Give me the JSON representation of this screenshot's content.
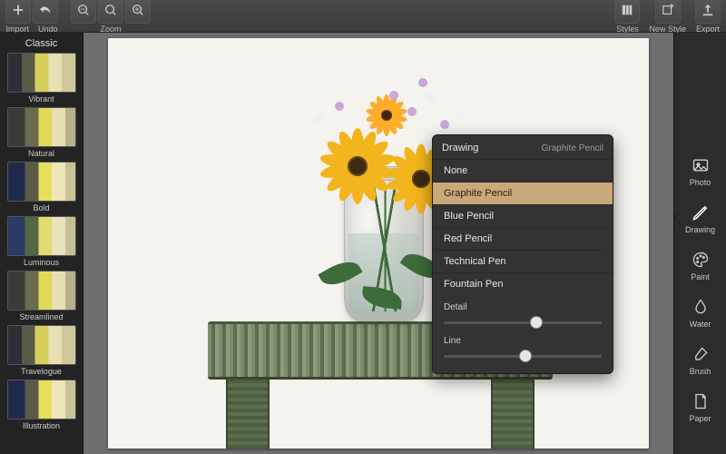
{
  "toolbar": {
    "import_label": "Import",
    "undo_label": "Undo",
    "zoom_label": "Zoom",
    "styles_label": "Styles",
    "new_style_label": "New Style",
    "export_label": "Export"
  },
  "sidebar": {
    "title": "Classic",
    "presets": [
      {
        "label": "Vibrant"
      },
      {
        "label": "Natural"
      },
      {
        "label": "Bold"
      },
      {
        "label": "Luminous"
      },
      {
        "label": "Streamlined"
      },
      {
        "label": "Travelogue"
      },
      {
        "label": "Illustration"
      }
    ]
  },
  "panel": {
    "title": "Drawing",
    "subtitle": "Graphite Pencil",
    "options": [
      {
        "label": "None",
        "selected": false
      },
      {
        "label": "Graphite Pencil",
        "selected": true
      },
      {
        "label": "Blue Pencil",
        "selected": false
      },
      {
        "label": "Red Pencil",
        "selected": false
      },
      {
        "label": "Technical Pen",
        "selected": false
      },
      {
        "label": "Fountain Pen",
        "selected": false
      }
    ],
    "sliders": [
      {
        "label": "Detail",
        "value": 0.55
      },
      {
        "label": "Line",
        "value": 0.48
      }
    ]
  },
  "rail": {
    "tabs": [
      {
        "label": "Photo",
        "active": false
      },
      {
        "label": "Drawing",
        "active": true
      },
      {
        "label": "Paint",
        "active": false
      },
      {
        "label": "Water",
        "active": false
      },
      {
        "label": "Brush",
        "active": false
      },
      {
        "label": "Paper",
        "active": false
      }
    ]
  }
}
